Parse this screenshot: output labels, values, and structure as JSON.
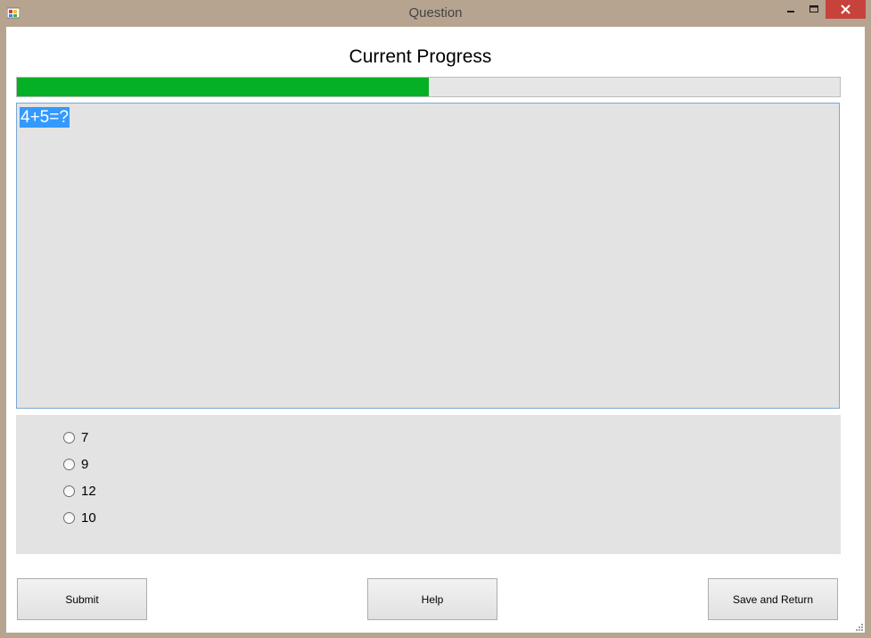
{
  "window": {
    "title": "Question",
    "icon": "app-icon",
    "controls": [
      "minimize-icon",
      "maximize-icon",
      "close-icon"
    ]
  },
  "progress": {
    "title": "Current Progress",
    "value_fraction": 0.5,
    "fill_color": "#06b025"
  },
  "question": {
    "text": "4+5=?",
    "selection_color": "#3399ff"
  },
  "options": [
    {
      "label": "7",
      "checked": false
    },
    {
      "label": "9",
      "checked": false
    },
    {
      "label": "12",
      "checked": false
    },
    {
      "label": "10",
      "checked": false
    }
  ],
  "buttons": {
    "submit": "Submit",
    "help": "Help",
    "save": "Save and Return"
  }
}
